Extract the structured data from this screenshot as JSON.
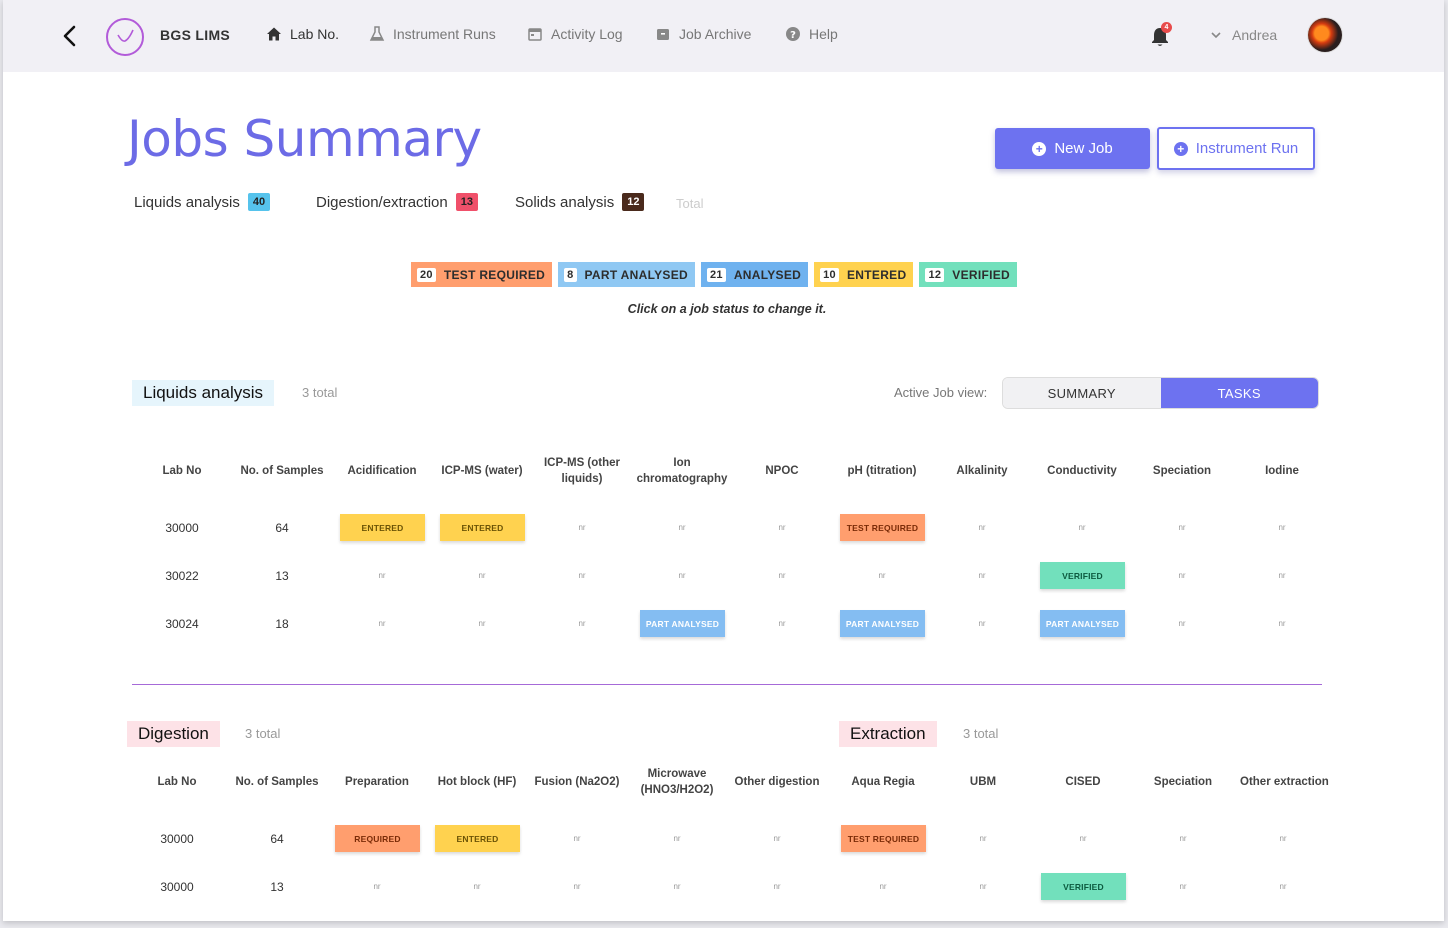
{
  "nav": {
    "brand": "BGS LIMS",
    "items": [
      {
        "label": "Lab No.",
        "icon": "home-icon"
      },
      {
        "label": "Instrument Runs",
        "icon": "flask-icon"
      },
      {
        "label": "Activity Log",
        "icon": "calendar-icon"
      },
      {
        "label": "Job Archive",
        "icon": "archive-icon"
      },
      {
        "label": "Help",
        "icon": "help-icon"
      }
    ],
    "notifications": "4",
    "user": "Andrea"
  },
  "header": {
    "title": "Jobs Summary",
    "new_job": "New Job",
    "instrument_run": "Instrument Run",
    "counts": [
      {
        "label": "Liquids analysis",
        "value": "40",
        "color": "#56c3ec"
      },
      {
        "label": "Digestion/extraction",
        "value": "13",
        "color": "#f0506a"
      },
      {
        "label": "Solids analysis",
        "value": "12",
        "color": "#4a2a1c"
      }
    ],
    "total_label": "Total"
  },
  "statuses": [
    {
      "count": "20",
      "label": "TEST REQUIRED",
      "color": "#ff9e6e"
    },
    {
      "count": "8",
      "label": "PART ANALYSED",
      "color": "#8fc8f3"
    },
    {
      "count": "21",
      "label": "ANALYSED",
      "color": "#6fb2ef"
    },
    {
      "count": "10",
      "label": "ENTERED",
      "color": "#ffd24f"
    },
    {
      "count": "12",
      "label": "VERIFIED",
      "color": "#72e0bc"
    }
  ],
  "hint": "Click on a job status to change it.",
  "liquids": {
    "title": "Liquids analysis",
    "total": "3 total",
    "view_label": "Active Job view:",
    "view_summary": "SUMMARY",
    "view_tasks": "TASKS",
    "columns": [
      "Lab No",
      "No. of Samples",
      "Acidification",
      "ICP-MS (water)",
      "ICP-MS (other liquids)",
      "Ion chromatography",
      "NPOC",
      "pH (titration)",
      "Alkalinity",
      "Conductivity",
      "Speciation",
      "Iodine"
    ],
    "rows": [
      {
        "lab": "30000",
        "samples": "64",
        "cells": [
          "ENTERED",
          "ENTERED",
          "nr",
          "nr",
          "nr",
          "TEST REQUIRED",
          "nr",
          "nr",
          "nr",
          "nr"
        ]
      },
      {
        "lab": "30022",
        "samples": "13",
        "cells": [
          "nr",
          "nr",
          "nr",
          "nr",
          "nr",
          "nr",
          "nr",
          "VERIFIED",
          "nr",
          "nr"
        ]
      },
      {
        "lab": "30024",
        "samples": "18",
        "cells": [
          "nr",
          "nr",
          "nr",
          "PART ANALYSED",
          "nr",
          "PART ANALYSED",
          "nr",
          "PART ANALYSED",
          "nr",
          "nr"
        ]
      }
    ]
  },
  "digestion": {
    "title": "Digestion",
    "total": "3 total",
    "extraction_title": "Extraction",
    "extraction_total": "3 total",
    "columns": [
      "Lab No",
      "No. of Samples",
      "Preparation",
      "Hot block (HF)",
      "Fusion (Na2O2)",
      "Microwave (HNO3/H2O2)",
      "Other digestion",
      "Aqua Regia",
      "UBM",
      "CISED",
      "Speciation",
      "Other extraction"
    ],
    "rows": [
      {
        "lab": "30000",
        "samples": "64",
        "cells": [
          "REQUIRED",
          "ENTERED",
          "nr",
          "nr",
          "nr",
          "TEST REQUIRED",
          "nr",
          "nr",
          "nr",
          "nr"
        ]
      },
      {
        "lab": "30000",
        "samples": "13",
        "cells": [
          "nr",
          "nr",
          "nr",
          "nr",
          "nr",
          "nr",
          "nr",
          "VERIFIED",
          "nr",
          "nr"
        ]
      }
    ]
  }
}
